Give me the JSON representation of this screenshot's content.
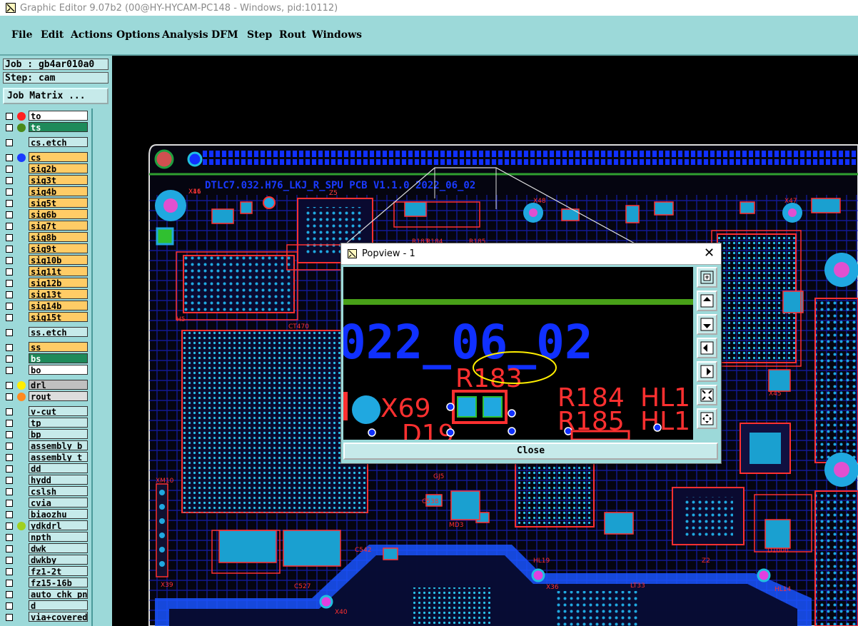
{
  "window": {
    "title": "Graphic Editor 9.07b2 (00@HY-HYCAM-PC148 - Windows, pid:10112)"
  },
  "menu": [
    {
      "label": "File"
    },
    {
      "label": "Edit"
    },
    {
      "label": "Actions"
    },
    {
      "label": "Options"
    },
    {
      "label": "Analysis"
    },
    {
      "label": "DFM"
    },
    {
      "label": "Step"
    },
    {
      "label": "Rout"
    },
    {
      "label": "Windows"
    }
  ],
  "job": {
    "job_label": "Job : gb4ar010a0",
    "step_label": "Step: cam",
    "matrix_button": "Job Matrix ..."
  },
  "layers": [
    {
      "name": "to",
      "bg": "#ffffff",
      "dot": "#ff2020"
    },
    {
      "name": "ts",
      "bg": "#1e8a5a",
      "dot": "#4a8a1a"
    },
    {
      "name": "cs.etch",
      "bg": "#c6eaea",
      "dot": ""
    },
    {
      "name": "cs",
      "bg": "#ffcc66",
      "dot": "#1a3aff"
    },
    {
      "name": "sig2b",
      "bg": "#ffcc66",
      "dot": ""
    },
    {
      "name": "sig3t",
      "bg": "#ffcc66",
      "dot": ""
    },
    {
      "name": "sig4b",
      "bg": "#ffcc66",
      "dot": ""
    },
    {
      "name": "sig5t",
      "bg": "#ffcc66",
      "dot": ""
    },
    {
      "name": "sig6b",
      "bg": "#ffcc66",
      "dot": ""
    },
    {
      "name": "sig7t",
      "bg": "#ffcc66",
      "dot": ""
    },
    {
      "name": "sig8b",
      "bg": "#ffcc66",
      "dot": ""
    },
    {
      "name": "sig9t",
      "bg": "#ffcc66",
      "dot": ""
    },
    {
      "name": "sig10b",
      "bg": "#ffcc66",
      "dot": ""
    },
    {
      "name": "sig11t",
      "bg": "#ffcc66",
      "dot": ""
    },
    {
      "name": "sig12b",
      "bg": "#ffcc66",
      "dot": ""
    },
    {
      "name": "sig13t",
      "bg": "#ffcc66",
      "dot": ""
    },
    {
      "name": "sig14b",
      "bg": "#ffcc66",
      "dot": ""
    },
    {
      "name": "sig15t",
      "bg": "#ffcc66",
      "dot": ""
    },
    {
      "name": "ss.etch",
      "bg": "#c6eaea",
      "dot": ""
    },
    {
      "name": "ss",
      "bg": "#ffcc66",
      "dot": ""
    },
    {
      "name": "bs",
      "bg": "#1e8a5a",
      "dot": ""
    },
    {
      "name": "bo",
      "bg": "#ffffff",
      "dot": ""
    },
    {
      "name": "drl",
      "bg": "#c0c0c0",
      "dot": "#ffee00"
    },
    {
      "name": "rout",
      "bg": "#dddddd",
      "dot": "#ff8a20"
    },
    {
      "name": "v-cut",
      "bg": "#c6eaea",
      "dot": ""
    },
    {
      "name": "tp",
      "bg": "#c6eaea",
      "dot": ""
    },
    {
      "name": "bp",
      "bg": "#c6eaea",
      "dot": ""
    },
    {
      "name": "assembly_b",
      "bg": "#c6eaea",
      "dot": ""
    },
    {
      "name": "assembly_t",
      "bg": "#c6eaea",
      "dot": ""
    },
    {
      "name": "dd",
      "bg": "#c6eaea",
      "dot": ""
    },
    {
      "name": "hydd",
      "bg": "#c6eaea",
      "dot": ""
    },
    {
      "name": "cslsh",
      "bg": "#c6eaea",
      "dot": ""
    },
    {
      "name": "cvia",
      "bg": "#c6eaea",
      "dot": ""
    },
    {
      "name": "biaozhu",
      "bg": "#c6eaea",
      "dot": ""
    },
    {
      "name": "ydkdrl",
      "bg": "#c6eaea",
      "dot": "#a0d020"
    },
    {
      "name": "npth",
      "bg": "#c6eaea",
      "dot": ""
    },
    {
      "name": "dwk",
      "bg": "#c6eaea",
      "dot": ""
    },
    {
      "name": "dwkby",
      "bg": "#c6eaea",
      "dot": ""
    },
    {
      "name": "fz1-2t",
      "bg": "#c6eaea",
      "dot": ""
    },
    {
      "name": "fz15-16b",
      "bg": "#c6eaea",
      "dot": ""
    },
    {
      "name": "auto_chk_pn",
      "bg": "#c6eaea",
      "dot": ""
    },
    {
      "name": "d",
      "bg": "#c6eaea",
      "dot": ""
    },
    {
      "name": "via+covered",
      "bg": "#c6eaea",
      "dot": ""
    }
  ],
  "pcb": {
    "board_title": "DTLC7.032.H76_LKJ_R_SPU PCB V1.1.0 2022_06_02",
    "labels": [
      "X16",
      "Z5",
      "X69",
      "D19",
      "R183",
      "R184",
      "R185",
      "X48",
      "X47",
      "X39",
      "XM10",
      "C538",
      "MD3",
      "GJ5",
      "C542",
      "X40",
      "C527",
      "HL19",
      "LT33",
      "Z2",
      "X36",
      "H5",
      "CT470",
      "D1000",
      "HL14",
      "X45",
      "X41"
    ]
  },
  "popview": {
    "title": "Popview - 1",
    "close_label": "Close",
    "zoom_text": "022_06_02",
    "labels": [
      "R183",
      "R184",
      "R185",
      "X69",
      "D19",
      "HL1",
      "HL1"
    ],
    "highlight_color": "#ffee00"
  },
  "colors": {
    "panel": "#9cd9d9",
    "trace": "#0a2aff",
    "pad": "#1aa0d0",
    "silk": "#ff2020",
    "outline": "#ff3030"
  }
}
